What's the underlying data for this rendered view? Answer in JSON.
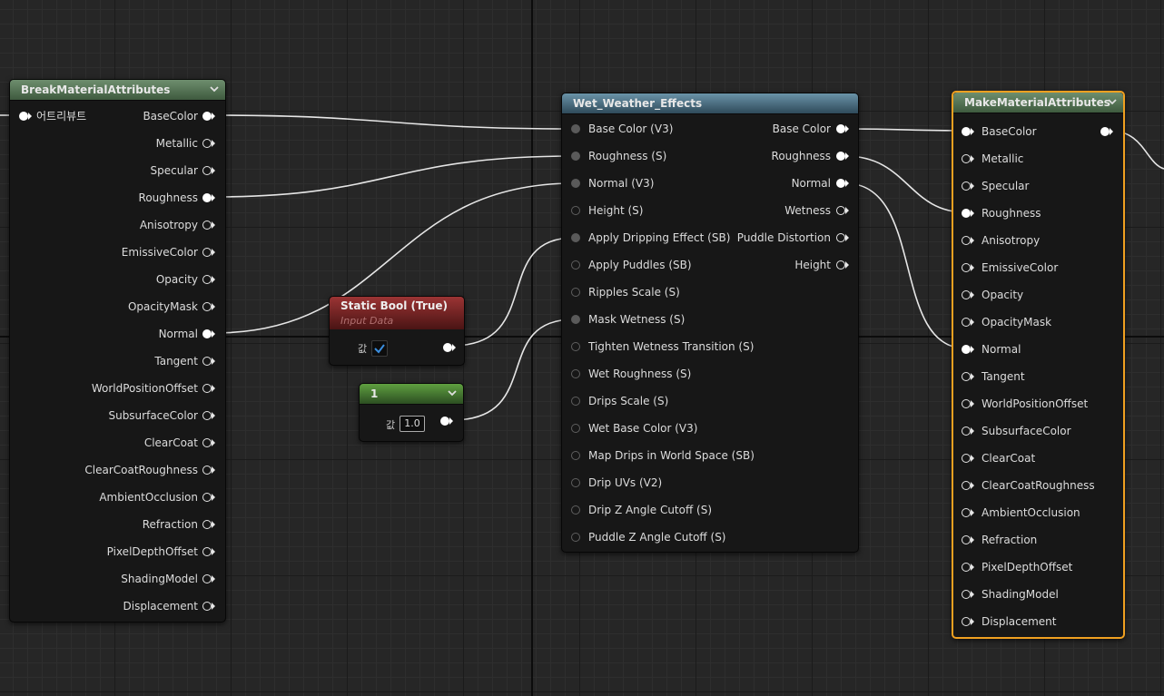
{
  "break_node": {
    "title": "BreakMaterialAttributes",
    "input_label": "어트리뷰트",
    "outputs": [
      "BaseColor",
      "Metallic",
      "Specular",
      "Roughness",
      "Anisotropy",
      "EmissiveColor",
      "Opacity",
      "OpacityMask",
      "Normal",
      "Tangent",
      "WorldPositionOffset",
      "SubsurfaceColor",
      "ClearCoat",
      "ClearCoatRoughness",
      "AmbientOcclusion",
      "Refraction",
      "PixelDepthOffset",
      "ShadingModel",
      "Displacement"
    ],
    "connected_outputs": [
      "BaseColor",
      "Roughness",
      "Normal"
    ]
  },
  "static_bool_node": {
    "title": "Static Bool (True)",
    "subtitle": "Input Data",
    "value_label": "값",
    "checked": true
  },
  "constant_node": {
    "title": "1",
    "value_label": "값",
    "value": "1.0"
  },
  "wet_node": {
    "title": "Wet_Weather_Effects",
    "inputs": [
      "Base Color (V3)",
      "Roughness (S)",
      "Normal (V3)",
      "Height (S)",
      "Apply Dripping Effect (SB)",
      "Apply Puddles (SB)",
      "Ripples Scale (S)",
      "Mask Wetness (S)",
      "Tighten Wetness Transition (S)",
      "Wet Roughness (S)",
      "Drips Scale (S)",
      "Wet Base Color (V3)",
      "Map Drips in World Space (SB)",
      "Drip UVs (V2)",
      "Drip Z Angle Cutoff (S)",
      "Puddle Z Angle Cutoff (S)"
    ],
    "connected_inputs": [
      "Base Color (V3)",
      "Roughness (S)",
      "Normal (V3)",
      "Apply Dripping Effect (SB)",
      "Mask Wetness (S)"
    ],
    "outputs": [
      "Base Color",
      "Roughness",
      "Normal",
      "Wetness",
      "Puddle Distortion",
      "Height"
    ],
    "connected_outputs": [
      "Base Color",
      "Roughness",
      "Normal"
    ]
  },
  "make_node": {
    "title": "MakeMaterialAttributes",
    "inputs": [
      "BaseColor",
      "Metallic",
      "Specular",
      "Roughness",
      "Anisotropy",
      "EmissiveColor",
      "Opacity",
      "OpacityMask",
      "Normal",
      "Tangent",
      "WorldPositionOffset",
      "SubsurfaceColor",
      "ClearCoat",
      "ClearCoatRoughness",
      "AmbientOcclusion",
      "Refraction",
      "PixelDepthOffset",
      "ShadingModel",
      "Displacement"
    ],
    "connected_inputs": [
      "BaseColor",
      "Roughness",
      "Normal"
    ],
    "selected": true
  },
  "colors": {
    "break_header": "#5b7a5b",
    "wet_header": "#4f7387",
    "static_bool_header": "#8a2a2a",
    "constant_header": "#4f7f3a",
    "selection_outline": "#f0a020",
    "wire": "#e6e6e6"
  },
  "icons": [
    "chevron-down-icon",
    "checkmark-icon",
    "pin-icon"
  ]
}
